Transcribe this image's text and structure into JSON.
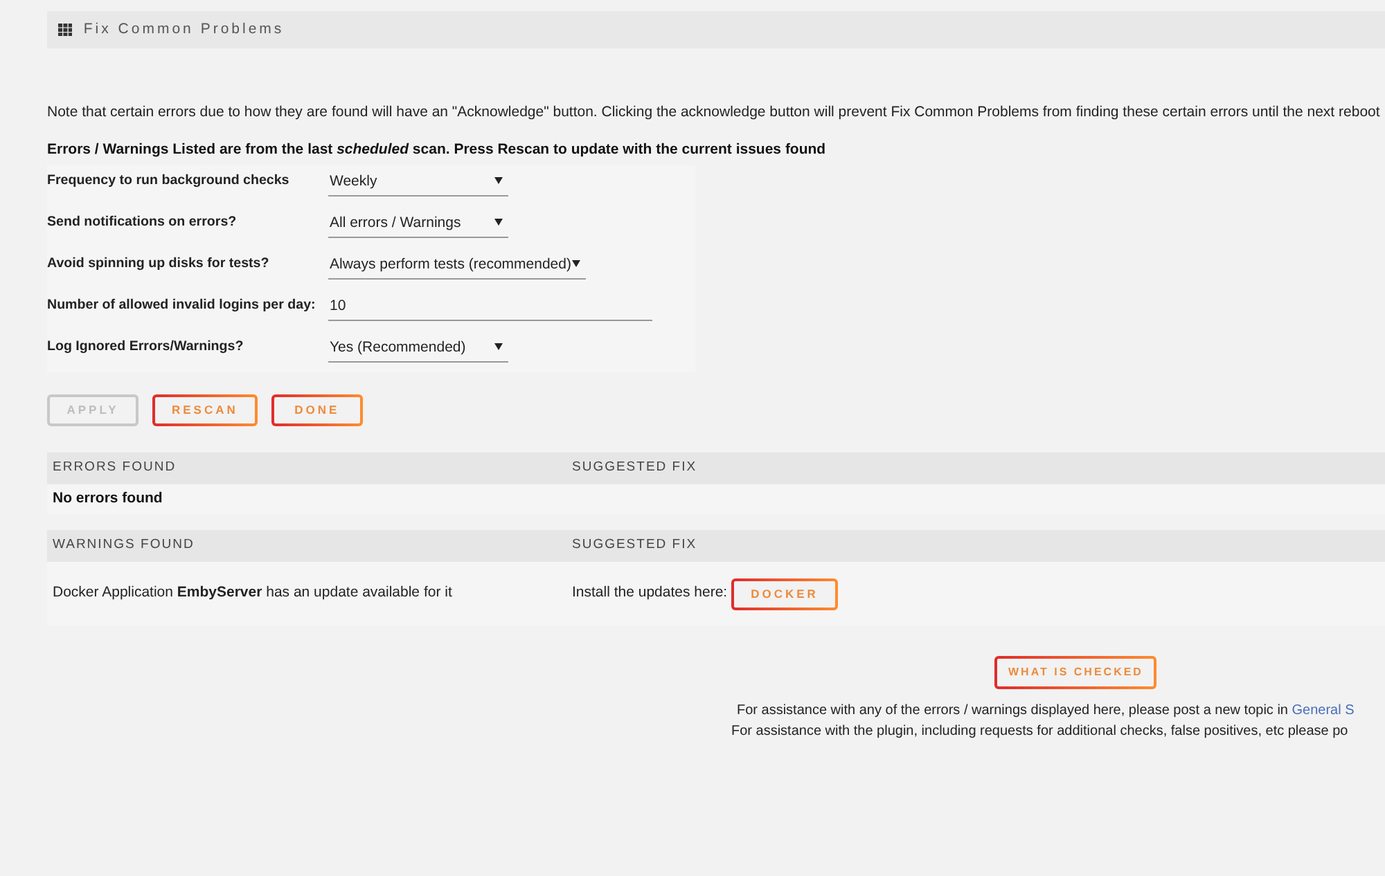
{
  "header": {
    "title": "Fix Common Problems"
  },
  "note": "Note that certain errors due to how they are found will have an \"Acknowledge\" button. Clicking the acknowledge button will prevent Fix Common Problems from finding these certain errors until the next reboot",
  "scan_info": "Errors / Warnings Listed are from the last *scheduled* scan. Press Rescan to update with the current issues found",
  "settings": [
    {
      "kind": "select",
      "label": "Frequency to run background checks",
      "value": "Weekly"
    },
    {
      "kind": "select",
      "label": "Send notifications on errors?",
      "value": "All errors / Warnings"
    },
    {
      "kind": "select",
      "label": "Avoid spinning up disks for tests?",
      "value": "Always perform tests (recommended)"
    },
    {
      "kind": "input",
      "label": "Number of allowed invalid logins per day:",
      "value": "10"
    },
    {
      "kind": "select",
      "label": "Log Ignored Errors/Warnings?",
      "value": "Yes (Recommended)"
    }
  ],
  "buttons": [
    {
      "label": "APPLY",
      "disabled": true
    },
    {
      "label": "RESCAN",
      "disabled": false
    },
    {
      "label": "DONE",
      "disabled": false
    }
  ],
  "errors_table": {
    "columns": [
      "ERRORS FOUND",
      "SUGGESTED FIX"
    ],
    "rows": [
      {
        "kind": "empty",
        "text": "No errors found"
      }
    ]
  },
  "warnings_table": {
    "columns": [
      "WARNINGS FOUND",
      "SUGGESTED FIX"
    ],
    "rows": [
      {
        "kind": "issue",
        "text": "Docker Application **EmbyServer** has an update available for it",
        "fix": "Install the updates here:",
        "fix_button": "DOCKER"
      }
    ]
  },
  "what_is_checked_button": "WHAT IS CHECKED",
  "footer": [
    {
      "text": "For assistance with any of the errors / warnings displayed here, please post a new topic in",
      "link": "General S"
    },
    {
      "text": "For assistance with the plugin, including requests for additional checks, false positives, etc please po"
    }
  ]
}
